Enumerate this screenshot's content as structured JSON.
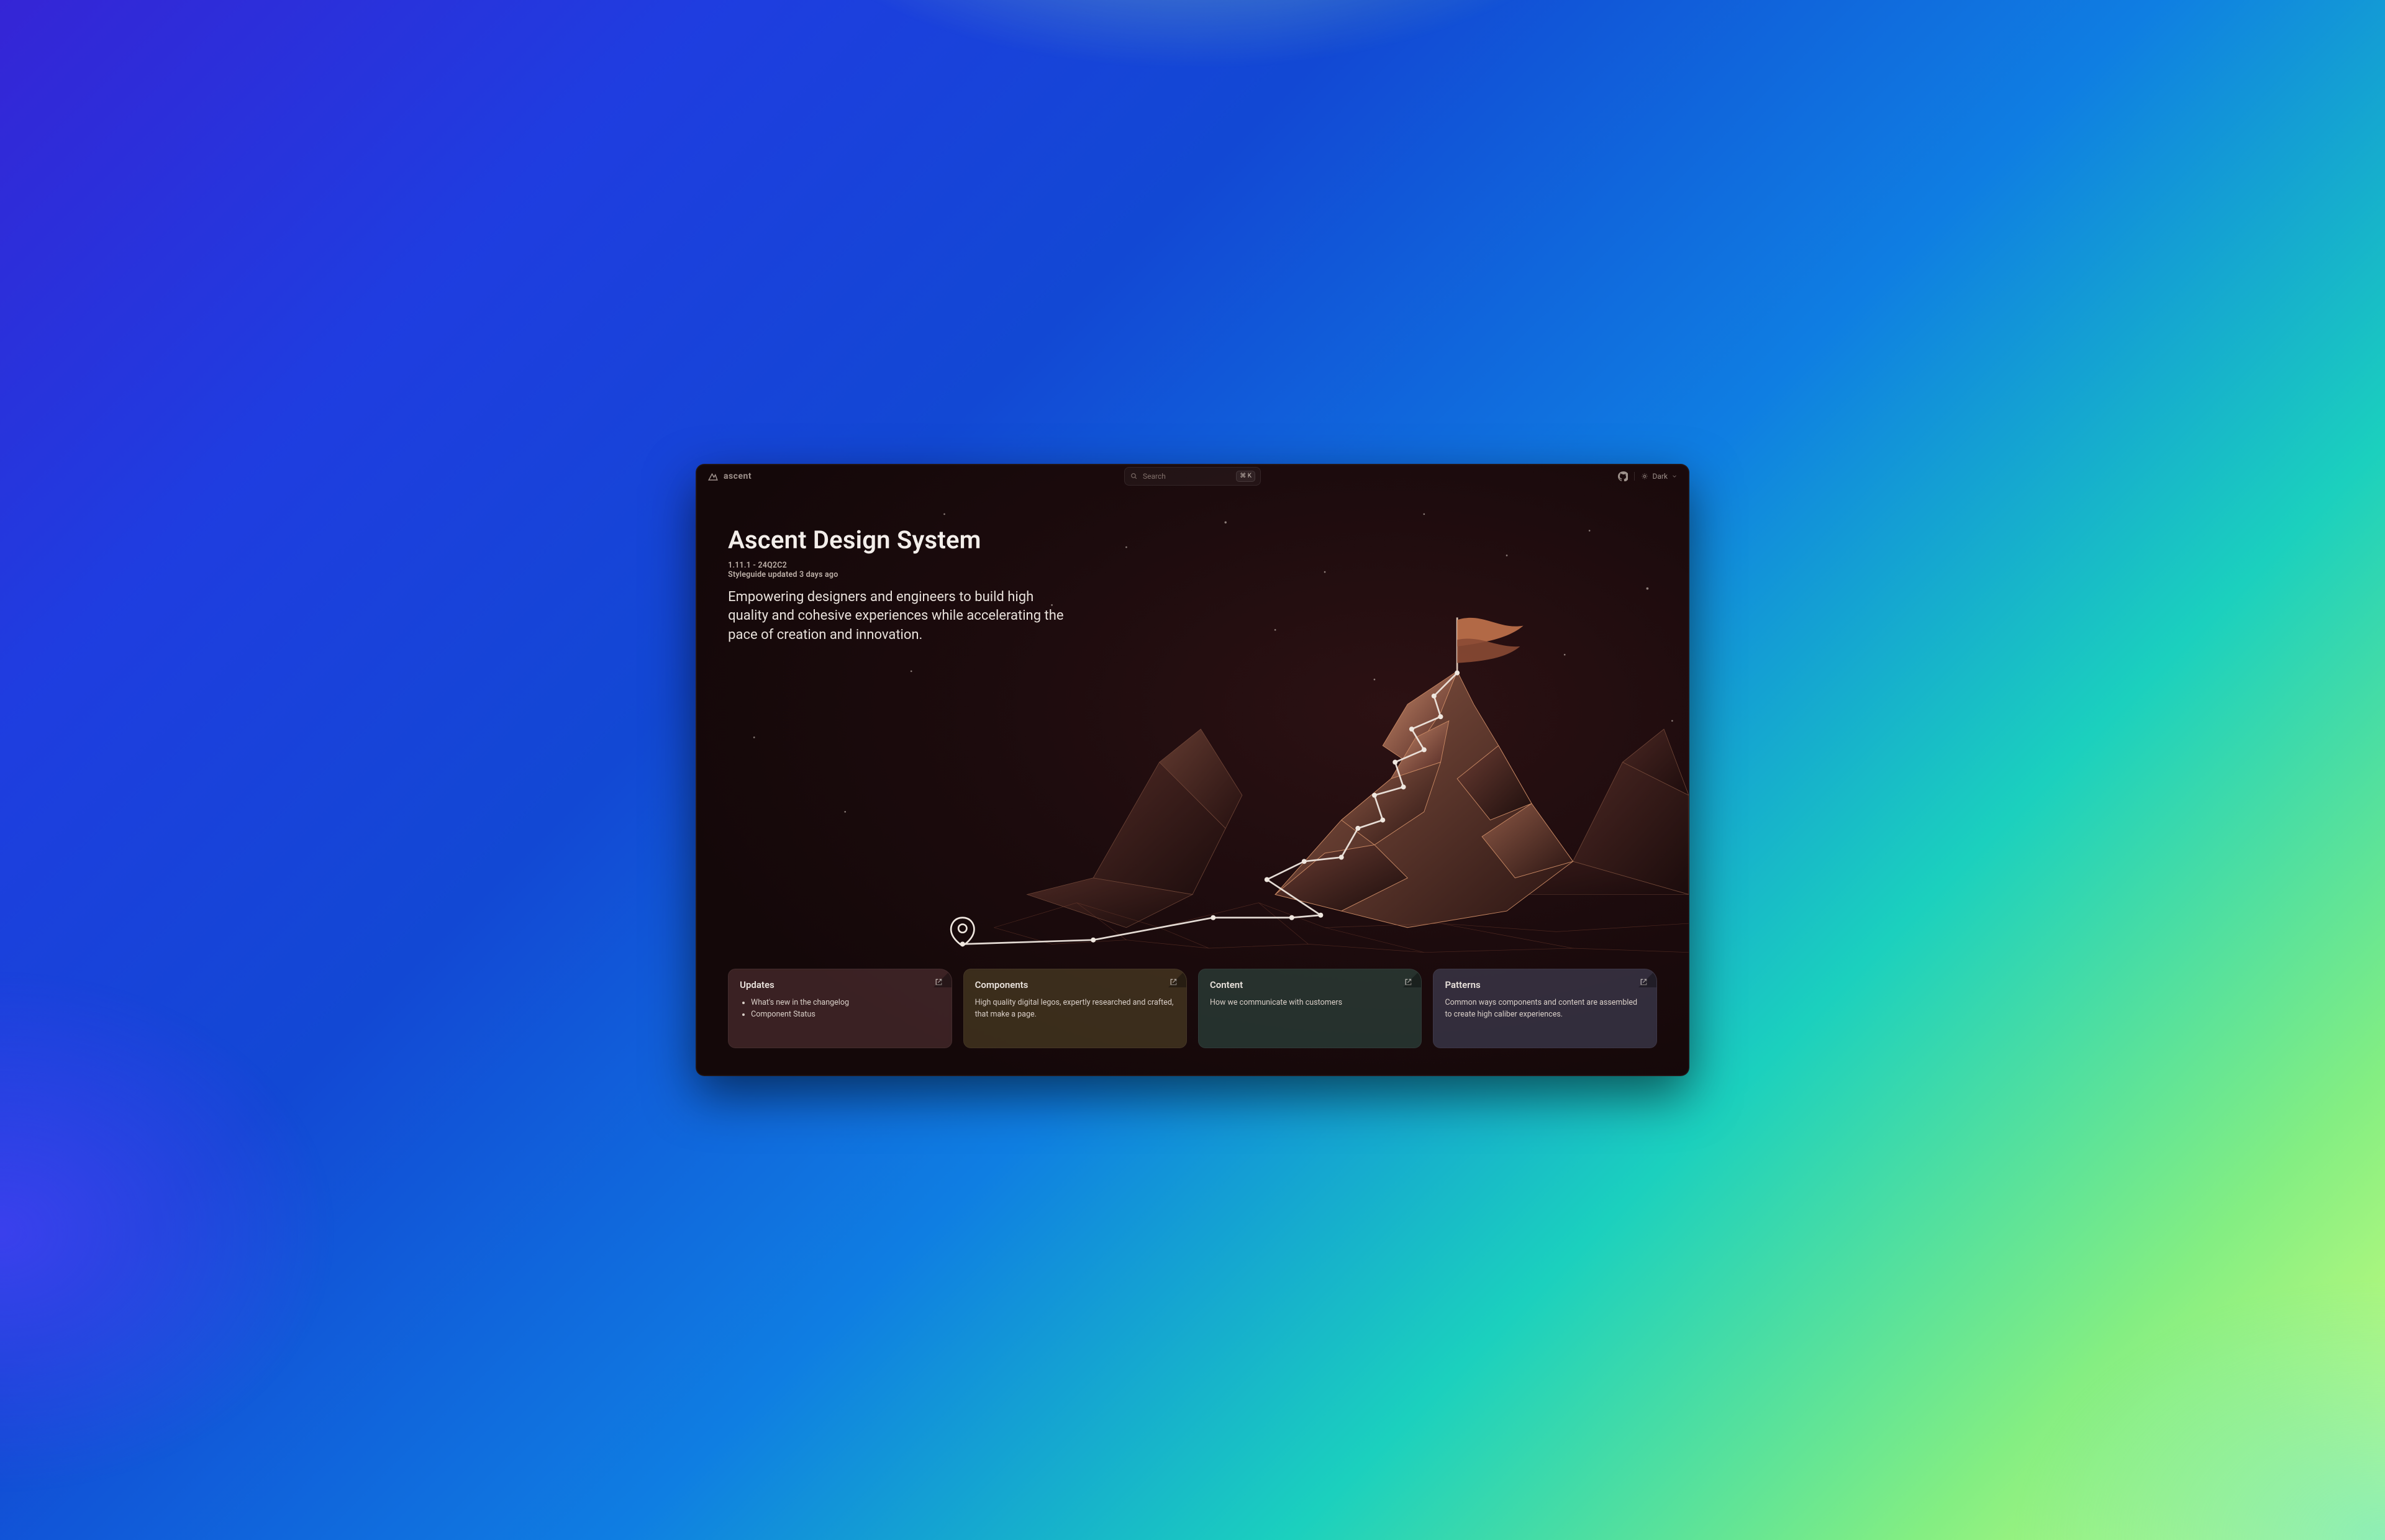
{
  "brand": {
    "name": "ascent"
  },
  "search": {
    "placeholder": "Search",
    "shortcut": "⌘ K"
  },
  "github_label": "GitHub",
  "theme": {
    "label": "Dark"
  },
  "hero": {
    "title": "Ascent Design System",
    "version_line": "1.11.1 - 24Q2C2",
    "updated_line": "Styleguide updated 3 days ago",
    "lead": "Empowering designers and engineers to build high quality and cohesive experiences while accelerating the pace of creation and innovation."
  },
  "cards": {
    "updates": {
      "title": "Updates",
      "items": [
        "What's new in the changelog",
        "Component Status"
      ]
    },
    "components": {
      "title": "Components",
      "desc": "High quality digital legos, expertly researched and crafted, that make a page."
    },
    "content": {
      "title": "Content",
      "desc": "How we communicate with customers"
    },
    "patterns": {
      "title": "Patterns",
      "desc": "Common ways components and content are assembled to create high caliber experiences."
    }
  }
}
